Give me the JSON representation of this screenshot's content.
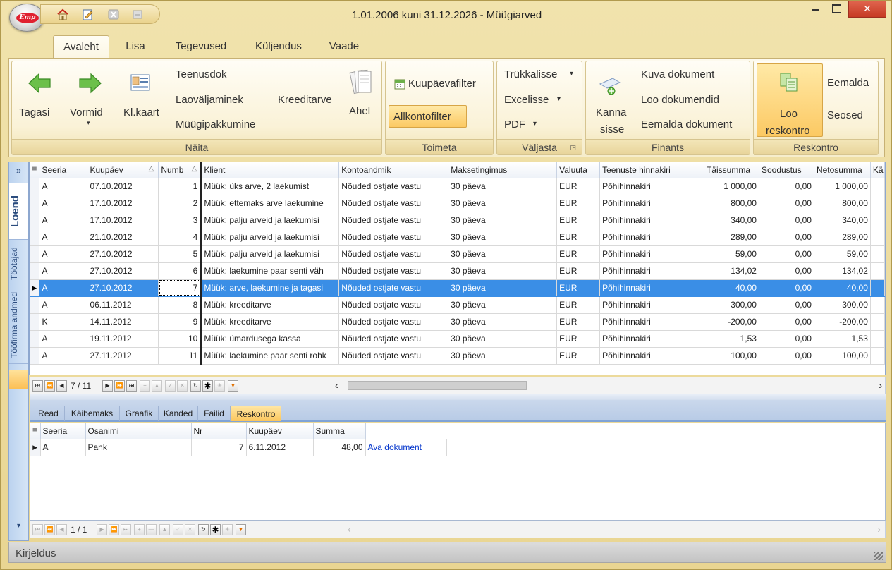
{
  "window": {
    "title": "1.01.2006 kuni 31.12.2026 - Müügiarved",
    "close_glyph": "✕",
    "logo_text": "Emp"
  },
  "ribbon_tabs": [
    "Avaleht",
    "Lisa",
    "Tegevused",
    "Küljendus",
    "Vaade"
  ],
  "ribbon": {
    "naita": {
      "title": "Näita",
      "back": "Tagasi",
      "forms": "Vormid",
      "card": "Kl.kaart",
      "service_docs": "Teenusdok",
      "warehouse_out": "Laoväljaminek",
      "sales_pack": "Müügipakkumine",
      "credit_invoice": "Kreeditarve",
      "chain": "Ahel"
    },
    "toimeta": {
      "title": "Toimeta",
      "date_filter": "Kuupäevafilter",
      "subaccount_filter": "Allkontofilter"
    },
    "valjasta": {
      "title": "Väljasta",
      "print": "Trükkalisse",
      "excel": "Excelisse",
      "pdf": "PDF",
      "caret": "▾"
    },
    "finants": {
      "title": "Finants",
      "post_line1": "Kanna",
      "post_line2": "sisse",
      "show_doc": "Kuva dokument",
      "create_docs": "Loo dokumendid",
      "remove_doc": "Eemalda dokument"
    },
    "reskontro": {
      "title": "Reskontro",
      "create_line1": "Loo",
      "create_line2": "reskontro",
      "remove": "Eemalda",
      "relations": "Seosed"
    }
  },
  "side_tabs": {
    "expand": "»",
    "list": "Loend",
    "employees": "Töötajad",
    "company": "Tööfirma andmed",
    "down": "▾"
  },
  "grid": {
    "columns": [
      "Seeria",
      "Kuupäev",
      "Numb",
      "Klient",
      "Kontoandmik",
      "Maksetingimus",
      "Valuuta",
      "Teenuste hinnakiri",
      "Täissumma",
      "Soodustus",
      "Netosumma",
      "Kä"
    ],
    "sort_glyph": "△",
    "row_marker": "▶",
    "rows": [
      [
        "A",
        "07.10.2012",
        "1",
        "Müük: üks arve, 2 laekumist",
        "Nõuded ostjate vastu",
        "30 päeva",
        "EUR",
        "Põhihinnakiri",
        "1 000,00",
        "0,00",
        "1 000,00"
      ],
      [
        "A",
        "17.10.2012",
        "2",
        "Müük: ettemaks arve laekumine",
        "Nõuded ostjate vastu",
        "30 päeva",
        "EUR",
        "Põhihinnakiri",
        "800,00",
        "0,00",
        "800,00"
      ],
      [
        "A",
        "17.10.2012",
        "3",
        "Müük: palju arveid ja laekumisi",
        "Nõuded ostjate vastu",
        "30 päeva",
        "EUR",
        "Põhihinnakiri",
        "340,00",
        "0,00",
        "340,00"
      ],
      [
        "A",
        "21.10.2012",
        "4",
        "Müük: palju arveid ja laekumisi",
        "Nõuded ostjate vastu",
        "30 päeva",
        "EUR",
        "Põhihinnakiri",
        "289,00",
        "0,00",
        "289,00"
      ],
      [
        "A",
        "27.10.2012",
        "5",
        "Müük: palju arveid ja laekumisi",
        "Nõuded ostjate vastu",
        "30 päeva",
        "EUR",
        "Põhihinnakiri",
        "59,00",
        "0,00",
        "59,00"
      ],
      [
        "A",
        "27.10.2012",
        "6",
        "Müük: laekumine paar senti väh",
        "Nõuded ostjate vastu",
        "30 päeva",
        "EUR",
        "Põhihinnakiri",
        "134,02",
        "0,00",
        "134,02"
      ],
      [
        "A",
        "27.10.2012",
        "7",
        "Müük: arve, laekumine ja tagasi",
        "Nõuded ostjate vastu",
        "30 päeva",
        "EUR",
        "Põhihinnakiri",
        "40,00",
        "0,00",
        "40,00"
      ],
      [
        "A",
        "06.11.2012",
        "8",
        "Müük: kreeditarve",
        "Nõuded ostjate vastu",
        "30 päeva",
        "EUR",
        "Põhihinnakiri",
        "300,00",
        "0,00",
        "300,00"
      ],
      [
        "K",
        "14.11.2012",
        "9",
        "Müük: kreeditarve",
        "Nõuded ostjate vastu",
        "30 päeva",
        "EUR",
        "Põhihinnakiri",
        "-200,00",
        "0,00",
        "-200,00"
      ],
      [
        "A",
        "19.11.2012",
        "10",
        "Müük: ümardusega kassa",
        "Nõuded ostjate vastu",
        "30 päeva",
        "EUR",
        "Põhihinnakiri",
        "1,53",
        "0,00",
        "1,53"
      ],
      [
        "A",
        "27.11.2012",
        "11",
        "Müük: laekumine paar senti rohk",
        "Nõuded ostjate vastu",
        "30 päeva",
        "EUR",
        "Põhihinnakiri",
        "100,00",
        "0,00",
        "100,00"
      ]
    ],
    "selected_row": 6
  },
  "navigator": {
    "position": "7 / 11",
    "buttons": [
      "⏮",
      "⏪",
      "◀",
      "▶",
      "⏩",
      "⏭",
      "+",
      "▲",
      "✓",
      "✕",
      "↻",
      "✱",
      "✳",
      "▼"
    ],
    "scroll_left": "‹",
    "scroll_right": "›"
  },
  "detail_tabs": [
    "Read",
    "Käibemaks",
    "Graafik",
    "Kanded",
    "Failid",
    "Reskontro"
  ],
  "detail_grid": {
    "columns": [
      "Seeria",
      "Osanimi",
      "Nr",
      "Kuupäev",
      "Summa",
      ""
    ],
    "rows": [
      [
        "A",
        "Pank",
        "7",
        "6.11.2012",
        "48,00",
        "Ava dokument"
      ]
    ]
  },
  "navigator2": {
    "position": "1 / 1"
  },
  "status": {
    "description": "Kirjeldus"
  },
  "colors": {
    "selection": "#3a8ee6",
    "accent": "#fbc65c"
  }
}
